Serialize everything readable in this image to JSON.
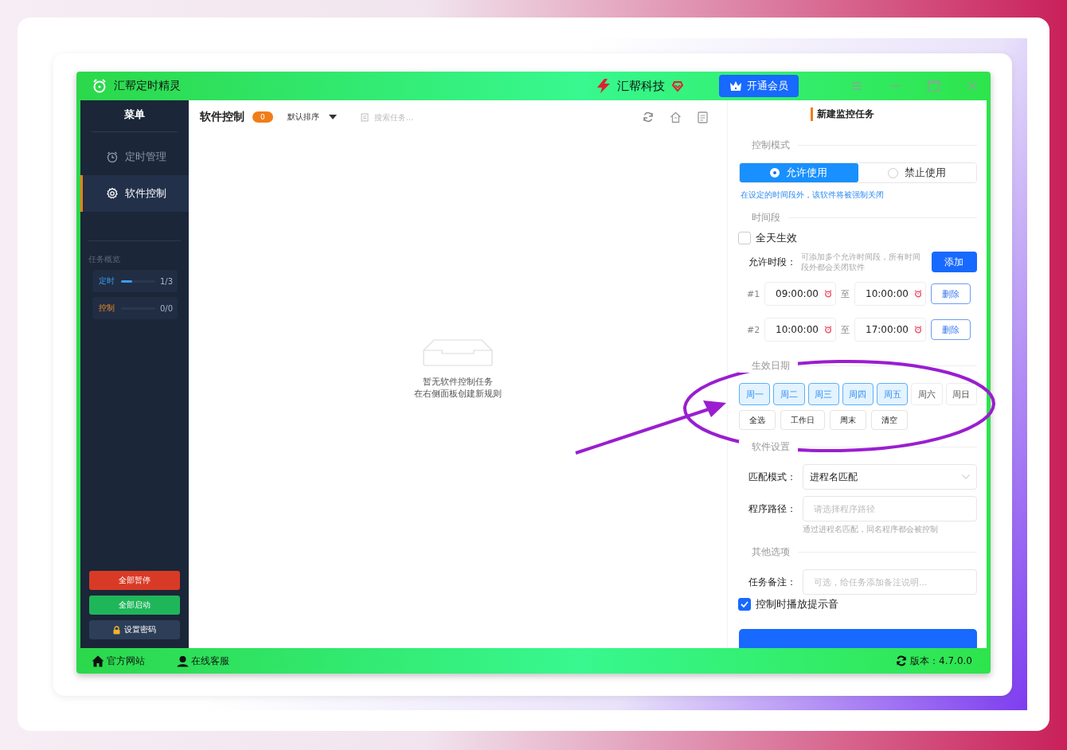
{
  "app": {
    "title": "汇帮定时精灵",
    "brand": "汇帮科技",
    "vip_button": "开通会员"
  },
  "sidebar": {
    "heading": "菜单",
    "items": [
      {
        "label": "定时管理",
        "selected": false
      },
      {
        "label": "软件控制",
        "selected": true
      }
    ],
    "overview_title": "任务概览",
    "stats": [
      {
        "label": "定时",
        "count": "1/3",
        "level": 0.33
      },
      {
        "label": "控制",
        "count": "0/0"
      }
    ],
    "actions": [
      {
        "label": "全部暂停",
        "kind": "danger"
      },
      {
        "label": "全部启动",
        "kind": "success"
      },
      {
        "label": "设置密码",
        "kind": "lock"
      }
    ]
  },
  "main": {
    "title": "软件控制",
    "count": "0",
    "sort": "默认排序",
    "search_placeholder": "搜索任务...",
    "empty_lines": [
      "暂无软件控制任务",
      "在右侧面板创建新规则"
    ]
  },
  "panel": {
    "title": "新建监控任务",
    "mode_label": "控制模式",
    "modes": [
      {
        "label": "允许使用",
        "selected": true
      },
      {
        "label": "禁止使用",
        "selected": false
      }
    ],
    "mode_hint": "在设定的时间段外，该软件将被强制关闭",
    "time_label": "时间段",
    "all_day": {
      "label": "全天生效",
      "checked": false
    },
    "allow_label": "允许时段：",
    "allow_hint": "可添加多个允许时间段，所有时间段外都会关闭软件",
    "add_button": "添加",
    "periods": [
      {
        "index": "#1",
        "start": "09:00:00",
        "to": "至",
        "end": "10:00:00",
        "delete": "删除"
      },
      {
        "index": "#2",
        "start": "10:00:00",
        "to": "至",
        "end": "17:00:00",
        "delete": "删除"
      }
    ],
    "date_label": "生效日期",
    "weekdays": [
      {
        "label": "周一",
        "selected": true
      },
      {
        "label": "周二",
        "selected": true
      },
      {
        "label": "周三",
        "selected": true
      },
      {
        "label": "周四",
        "selected": true
      },
      {
        "label": "周五",
        "selected": true
      },
      {
        "label": "周六",
        "selected": false
      },
      {
        "label": "周日",
        "selected": false
      }
    ],
    "quick": [
      "全选",
      "工作日",
      "周末",
      "清空"
    ],
    "software_label": "软件设置",
    "match_label": "匹配模式：",
    "match_value": "进程名匹配",
    "path_label": "程序路径：",
    "path_placeholder": "请选择程序路径",
    "path_hint": "通过进程名匹配，同名程序都会被控制",
    "other_label": "其他选项",
    "note_label": "任务备注：",
    "note_placeholder": "可选，给任务添加备注说明...",
    "sound": {
      "label": "控制时播放提示音",
      "checked": true
    }
  },
  "footer": {
    "links": [
      {
        "label": "官方网站"
      },
      {
        "label": "在线客服"
      }
    ],
    "version": "版本：4.7.0.0"
  }
}
